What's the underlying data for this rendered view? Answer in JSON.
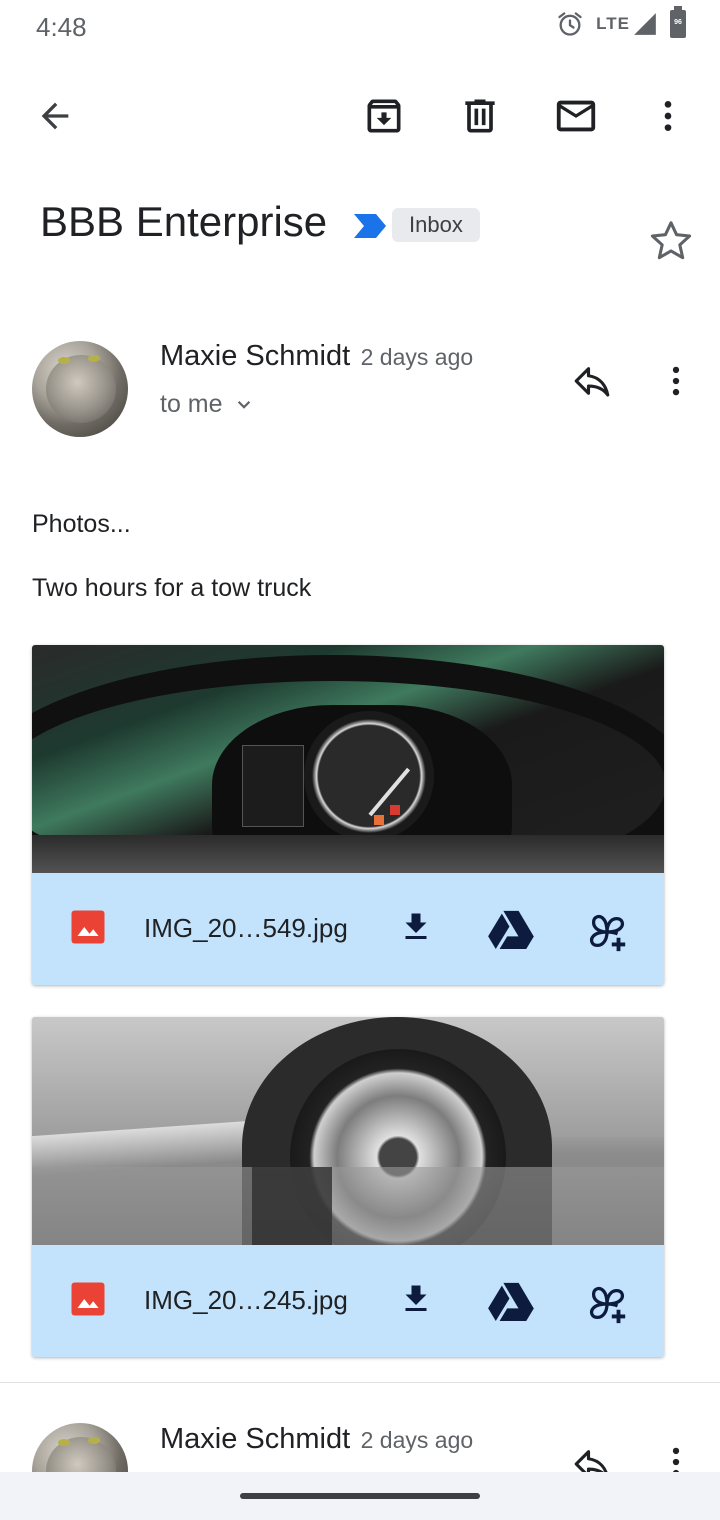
{
  "status_bar": {
    "time": "4:48",
    "network": "LTE",
    "battery": "96"
  },
  "toolbar": {
    "icons": [
      "back-arrow-icon",
      "archive-icon",
      "delete-icon",
      "mark-unread-icon",
      "more-vert-icon"
    ]
  },
  "email": {
    "subject": "BBB Enterprise",
    "label": "Inbox",
    "importance_color": "#1a73e8"
  },
  "messages": [
    {
      "sender": "Maxie Schmidt",
      "time": "2 days ago",
      "recipient": "to me",
      "body_lines": [
        "Photos...",
        "Two hours for a tow truck"
      ],
      "attachments": [
        {
          "filename": "IMG_20…549.jpg"
        },
        {
          "filename": "IMG_20…245.jpg"
        }
      ]
    },
    {
      "sender": "Maxie Schmidt",
      "time": "2 days ago"
    }
  ],
  "colors": {
    "attachment_bar": "#c2e3fb",
    "image_icon": "#ea4335",
    "icon_dark": "#0d1b3e"
  }
}
